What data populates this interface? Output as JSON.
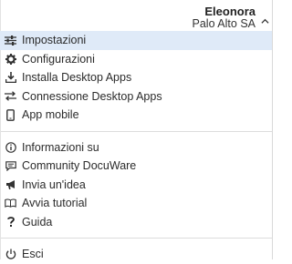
{
  "user": {
    "name": "Eleonora",
    "company": "Palo Alto SA"
  },
  "menu": {
    "group1": [
      {
        "label": "Impostazioni",
        "icon": "sliders-icon",
        "active": true
      },
      {
        "label": "Configurazioni",
        "icon": "gear-icon"
      },
      {
        "label": "Installa Desktop Apps",
        "icon": "download-icon"
      },
      {
        "label": "Connessione Desktop Apps",
        "icon": "swap-arrows-icon"
      },
      {
        "label": "App mobile",
        "icon": "mobile-phone-icon"
      }
    ],
    "group2": [
      {
        "label": "Informazioni su",
        "icon": "info-circle-icon"
      },
      {
        "label": "Community DocuWare",
        "icon": "chat-bubble-icon"
      },
      {
        "label": "Invia un'idea",
        "icon": "megaphone-icon"
      },
      {
        "label": "Avvia tutorial",
        "icon": "open-book-icon"
      },
      {
        "label": "Guida",
        "icon": "question-mark-icon"
      }
    ],
    "group3": [
      {
        "label": "Esci",
        "icon": "power-icon"
      }
    ]
  },
  "colors": {
    "active_bg": "#dfeaf8",
    "text": "#2b2b2b",
    "divider": "#dcdcdc"
  }
}
